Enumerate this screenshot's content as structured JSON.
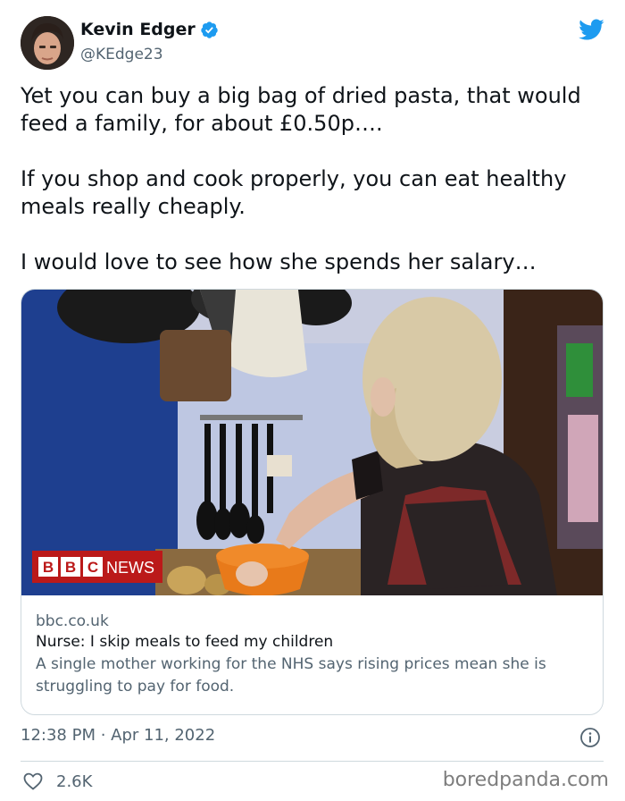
{
  "author": {
    "name": "Kevin Edger",
    "handle": "@KEdge23"
  },
  "tweet": {
    "paragraphs": [
      "Yet you can buy a big bag of dried pasta, that would feed a family, for about £0.50p….",
      "If you shop and cook properly, you can eat healthy meals really cheaply.",
      "I would love to see how she spends her salary…"
    ]
  },
  "card": {
    "image_logo_text": "BBC NEWS",
    "domain": "bbc.co.uk",
    "title": "Nurse: I skip meals to feed my children",
    "description": "A single mother working for the NHS says rising prices mean she is struggling to pay for food."
  },
  "meta": {
    "timestamp": "12:38 PM · Apr 11, 2022",
    "likes": "2.6K"
  },
  "watermark": "boredpanda.com",
  "colors": {
    "brand_blue": "#1d9bf0",
    "text_primary": "#0f1419",
    "text_secondary": "#536471",
    "bbc_red": "#bb1919"
  },
  "icons": {
    "verified": "verified-badge-icon",
    "bird": "twitter-bird-icon",
    "info": "info-icon",
    "heart": "heart-icon"
  }
}
